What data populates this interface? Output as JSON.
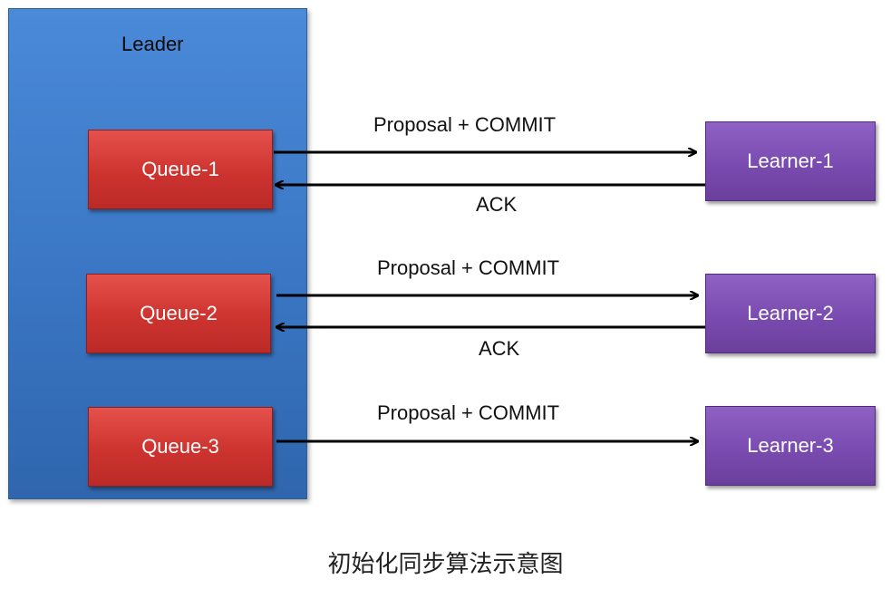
{
  "leader": {
    "title": "Leader"
  },
  "queues": [
    {
      "label": "Queue-1"
    },
    {
      "label": "Queue-2"
    },
    {
      "label": "Queue-3"
    }
  ],
  "learners": [
    {
      "label": "Learner-1"
    },
    {
      "label": "Learner-2"
    },
    {
      "label": "Learner-3"
    }
  ],
  "edges": [
    {
      "from": "Queue-1",
      "to": "Learner-1",
      "label": "Proposal + COMMIT"
    },
    {
      "from": "Learner-1",
      "to": "Queue-1",
      "label": "ACK"
    },
    {
      "from": "Queue-2",
      "to": "Learner-2",
      "label": "Proposal + COMMIT"
    },
    {
      "from": "Learner-2",
      "to": "Queue-2",
      "label": "ACK"
    },
    {
      "from": "Queue-3",
      "to": "Learner-3",
      "label": "Proposal + COMMIT"
    }
  ],
  "caption": "初始化同步算法示意图",
  "colors": {
    "leader": "#3a76c4",
    "queue": "#cd332f",
    "learner": "#7a4bb0",
    "arrow": "#000000"
  }
}
